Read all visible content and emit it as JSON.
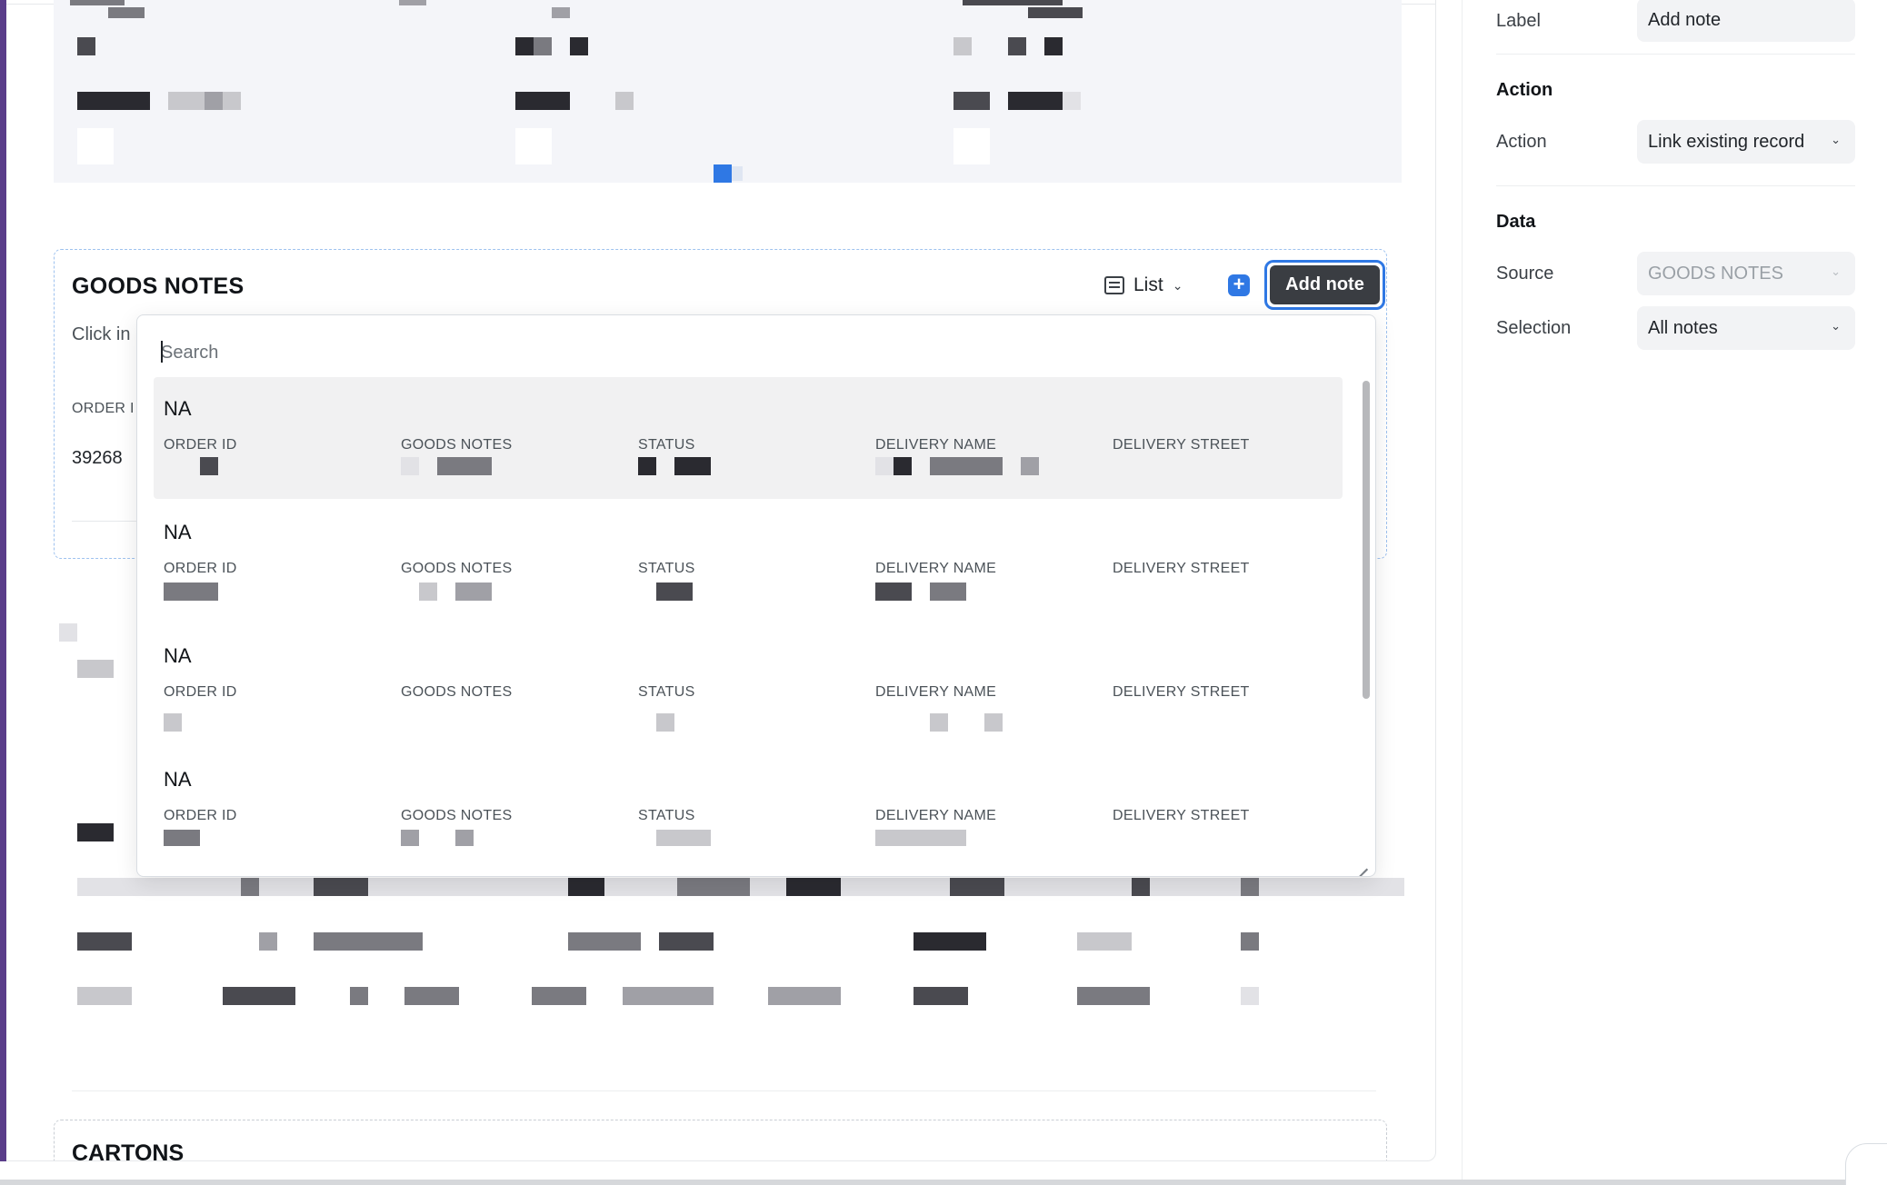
{
  "goods_notes": {
    "title": "GOODS NOTES",
    "hint": "Click in",
    "column_header": "ORDER I",
    "row_value": "39268",
    "view_toggle": "List",
    "add_button": "Add note",
    "plus_icon": "+"
  },
  "cartons": {
    "title": "CARTONS"
  },
  "popover": {
    "search_placeholder": "Search",
    "field_labels": [
      "ORDER ID",
      "GOODS NOTES",
      "STATUS",
      "DELIVERY NAME",
      "DELIVERY STREET"
    ],
    "results": [
      {
        "title": "NA",
        "active": true
      },
      {
        "title": "NA",
        "active": false
      },
      {
        "title": "NA",
        "active": false
      },
      {
        "title": "NA",
        "active": false
      }
    ]
  },
  "inspector": {
    "label_label": "Label",
    "label_value": "Add note",
    "action_section": "Action",
    "action_label": "Action",
    "action_value": "Link existing record",
    "data_section": "Data",
    "source_label": "Source",
    "source_value": "GOODS NOTES",
    "selection_label": "Selection",
    "selection_value": "All notes"
  },
  "colors": {
    "accent_bar": "#5a3d8a",
    "primary_blue": "#2f78e4",
    "dark_button": "#3a3d42"
  }
}
